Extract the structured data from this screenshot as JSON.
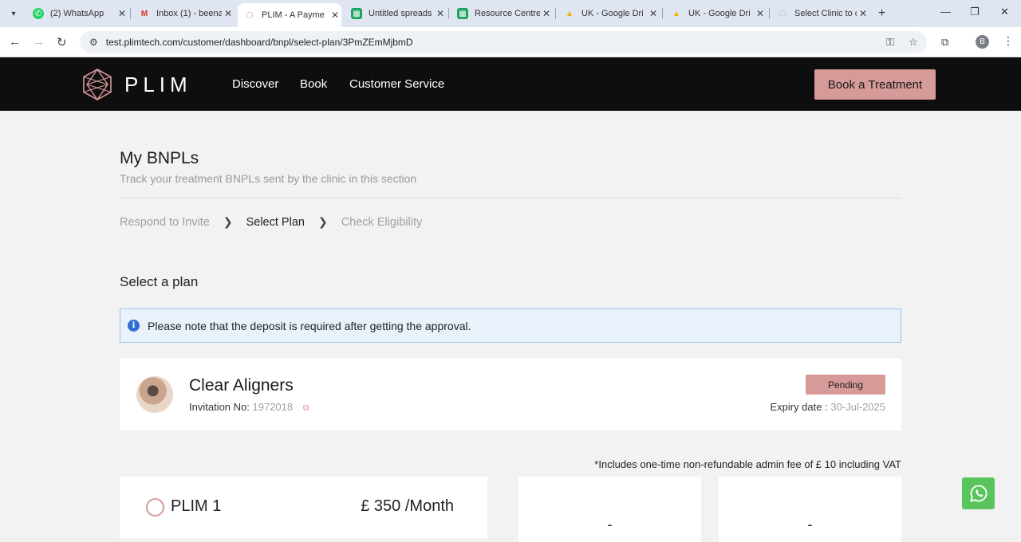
{
  "browser": {
    "tabs": [
      {
        "label": "(2) WhatsApp",
        "icon": "whatsapp-icon",
        "active": false
      },
      {
        "label": "Inbox (1) - beena",
        "icon": "gmail-icon",
        "active": false
      },
      {
        "label": "PLIM - A Payme",
        "icon": "plim-icon",
        "active": true
      },
      {
        "label": "Untitled spreads",
        "icon": "sheets-icon",
        "active": false
      },
      {
        "label": "Resource Centre",
        "icon": "sheets-icon",
        "active": false
      },
      {
        "label": "UK - Google Dri",
        "icon": "drive-icon",
        "active": false
      },
      {
        "label": "UK - Google Dri",
        "icon": "drive-icon",
        "active": false
      },
      {
        "label": "Select Clinic to c",
        "icon": "plim-icon",
        "active": false
      }
    ],
    "url": "test.plimtech.com/customer/dashboard/bnpl/select-plan/3PmZEmMjbmD",
    "profile_initial": "B"
  },
  "header": {
    "logo_text": "PLIM",
    "nav": [
      "Discover",
      "Book",
      "Customer Service"
    ],
    "cta": "Book a Treatment"
  },
  "page": {
    "title": "My BNPLs",
    "subtitle": "Track your treatment BNPLs sent by the clinic in this section",
    "breadcrumbs": [
      "Respond to Invite",
      "Select Plan",
      "Check Eligibility"
    ],
    "section_title": "Select a plan",
    "notice": "Please note that the deposit is required after getting the approval."
  },
  "treatment": {
    "title": "Clear Aligners",
    "invitation_label": "Invitation No:",
    "invitation_no": "1972018",
    "status": "Pending",
    "expiry_label": "Expiry date :",
    "expiry_date": "30-Jul-2025"
  },
  "fee_note": "*Includes one-time non-refundable admin fee of £ 10 including VAT",
  "plans": [
    {
      "name": "PLIM 1",
      "price": "£ 350 /Month"
    }
  ],
  "empty_plans": [
    "-",
    "-"
  ],
  "colors": {
    "accent": "#d69a98",
    "header_bg": "#0e0e0e",
    "notice_bg": "#e9f2fb",
    "whatsapp": "#59c45c"
  }
}
